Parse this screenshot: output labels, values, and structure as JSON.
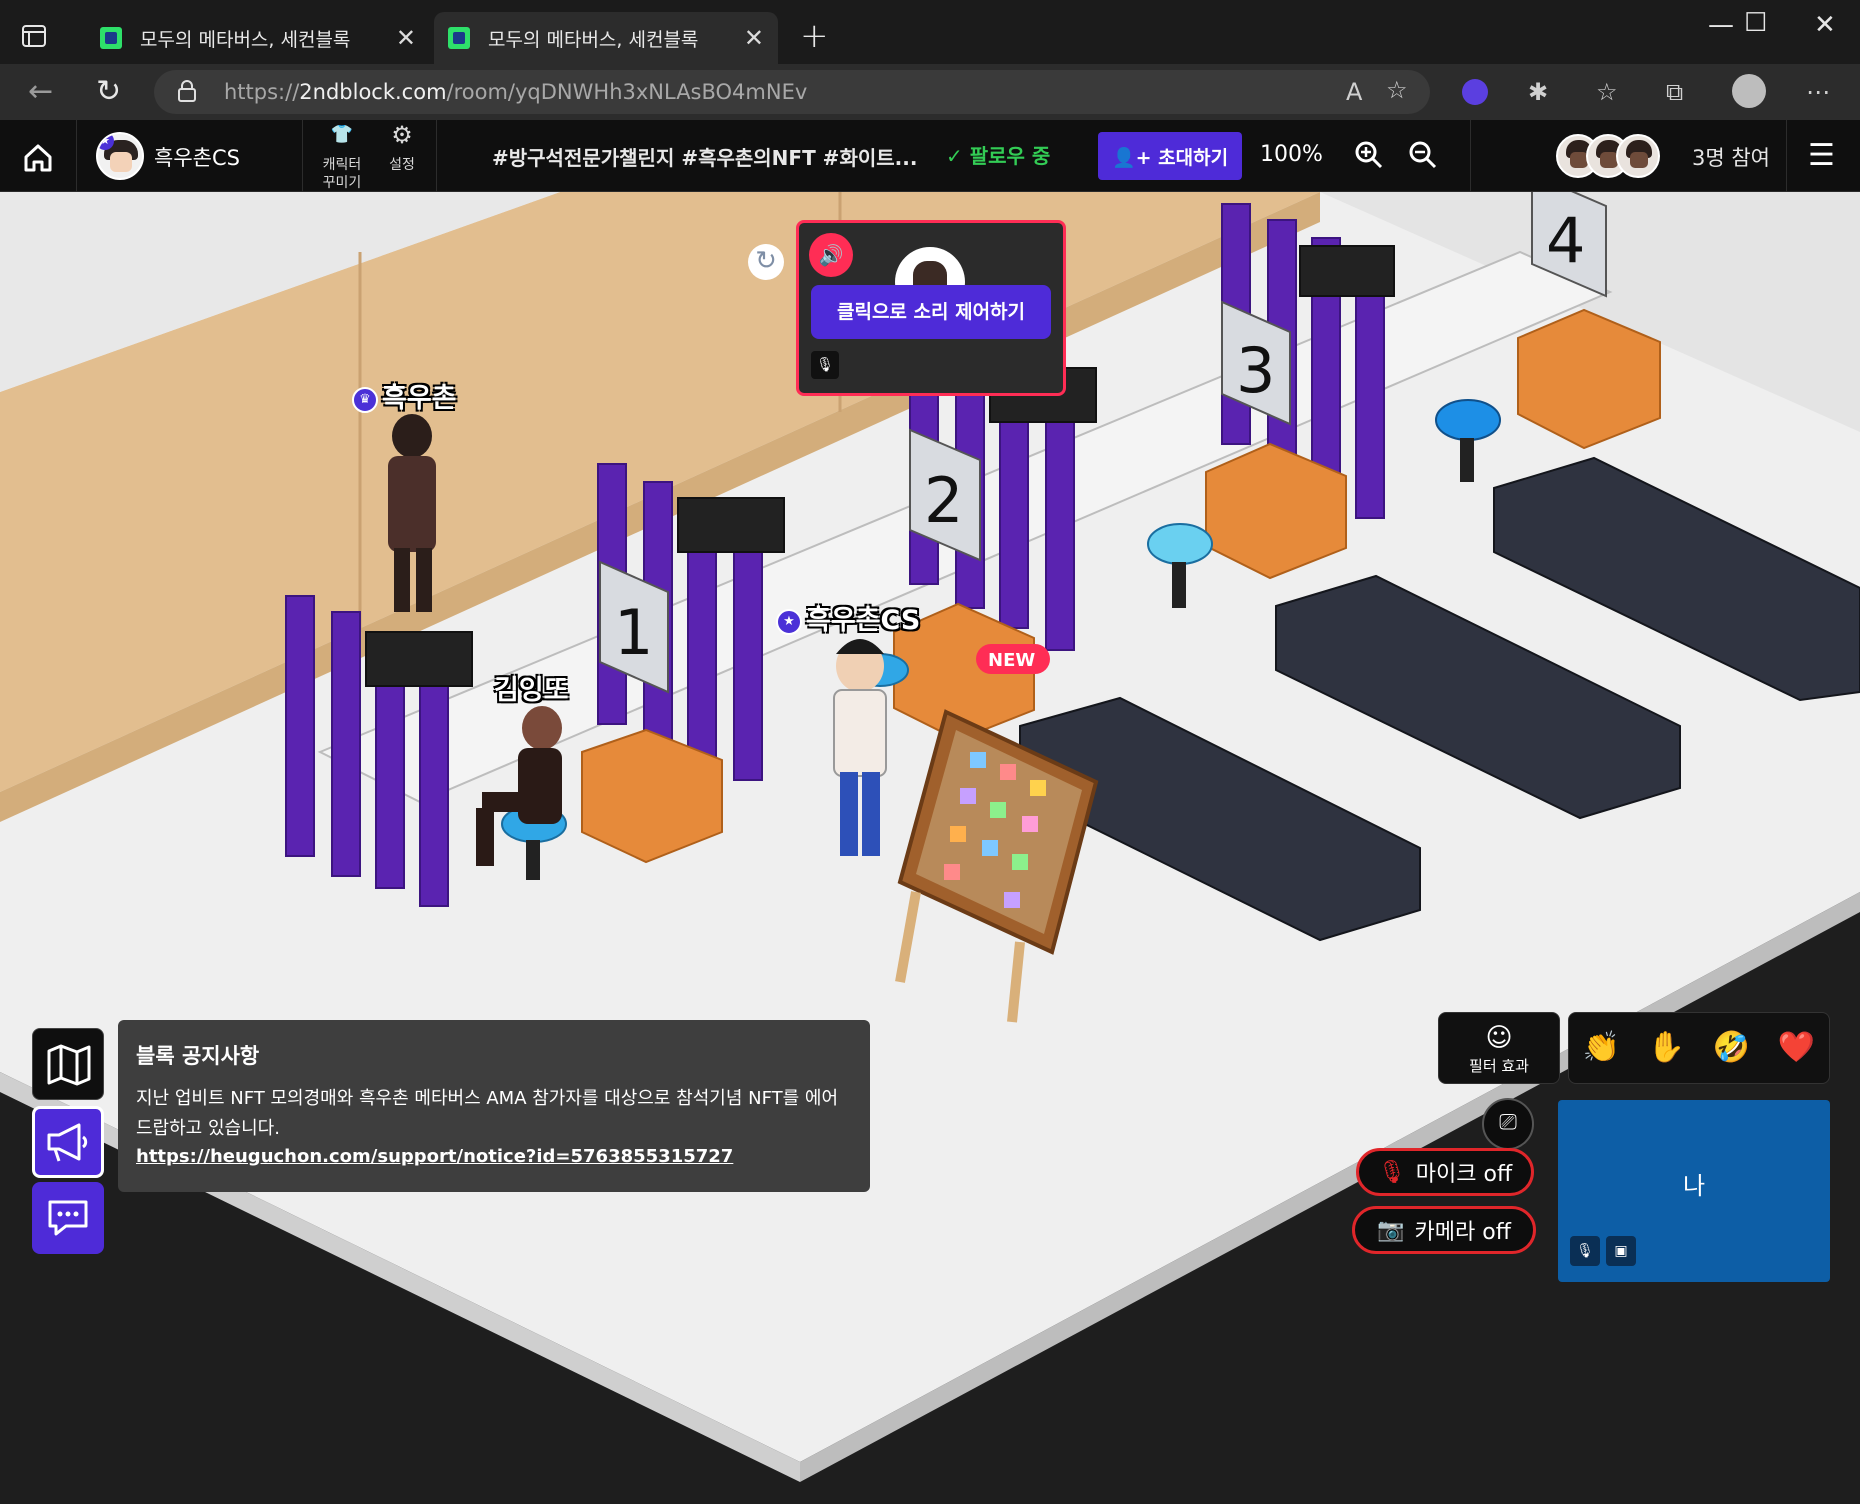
{
  "browser": {
    "tabs": [
      {
        "title": "모두의 메타버스, 세컨블록",
        "active": false
      },
      {
        "title": "모두의 메타버스, 세컨블록",
        "active": true
      }
    ],
    "url_prefix": "https://",
    "url_domain": "2ndblock.com",
    "url_path": "/room/yqDNWHh3xNLAsBO4mNEv"
  },
  "header": {
    "room_name": "흑우촌CS",
    "tool_character": "캐릭터\n꾸미기",
    "tool_settings": "설정",
    "tags": "#방구석전문가챌린지  #흑우촌의NFT  #화이트...",
    "follow_status": "팔로우 중",
    "invite_label": "초대하기",
    "zoom_level": "100%",
    "participants": "3명 참여"
  },
  "scene": {
    "characters": [
      {
        "name": "흑우촌",
        "crown": true
      },
      {
        "name": "흑우촌CS",
        "crown": true
      },
      {
        "name": "김잉또",
        "crown": false
      }
    ],
    "booth_numbers": [
      "1",
      "2",
      "3",
      "4"
    ],
    "new_badge": "NEW",
    "audio_popup": {
      "tooltip": "클릭으로 소리 제어하기"
    }
  },
  "notice": {
    "title": "블록 공지사항",
    "body": "지난 업비트 NFT 모의경매와 흑우촌 메타버스 AMA 참가자를 대상으로 참석기념 NFT를 에어드랍하고 있습니다.",
    "link": "https://heuguchon.com/support/notice?id=5763855315727"
  },
  "controls": {
    "filter_label": "필터 효과",
    "emojis": [
      "👏",
      "✋",
      "🤣",
      "❤️"
    ],
    "mic_label": "마이크 off",
    "camera_label": "카메라 off",
    "self_label": "나"
  },
  "colors": {
    "accent": "#4e2bd8",
    "alert_red": "#e0262a",
    "follow_green": "#33cc55",
    "self_tile": "#0d5ea6"
  }
}
